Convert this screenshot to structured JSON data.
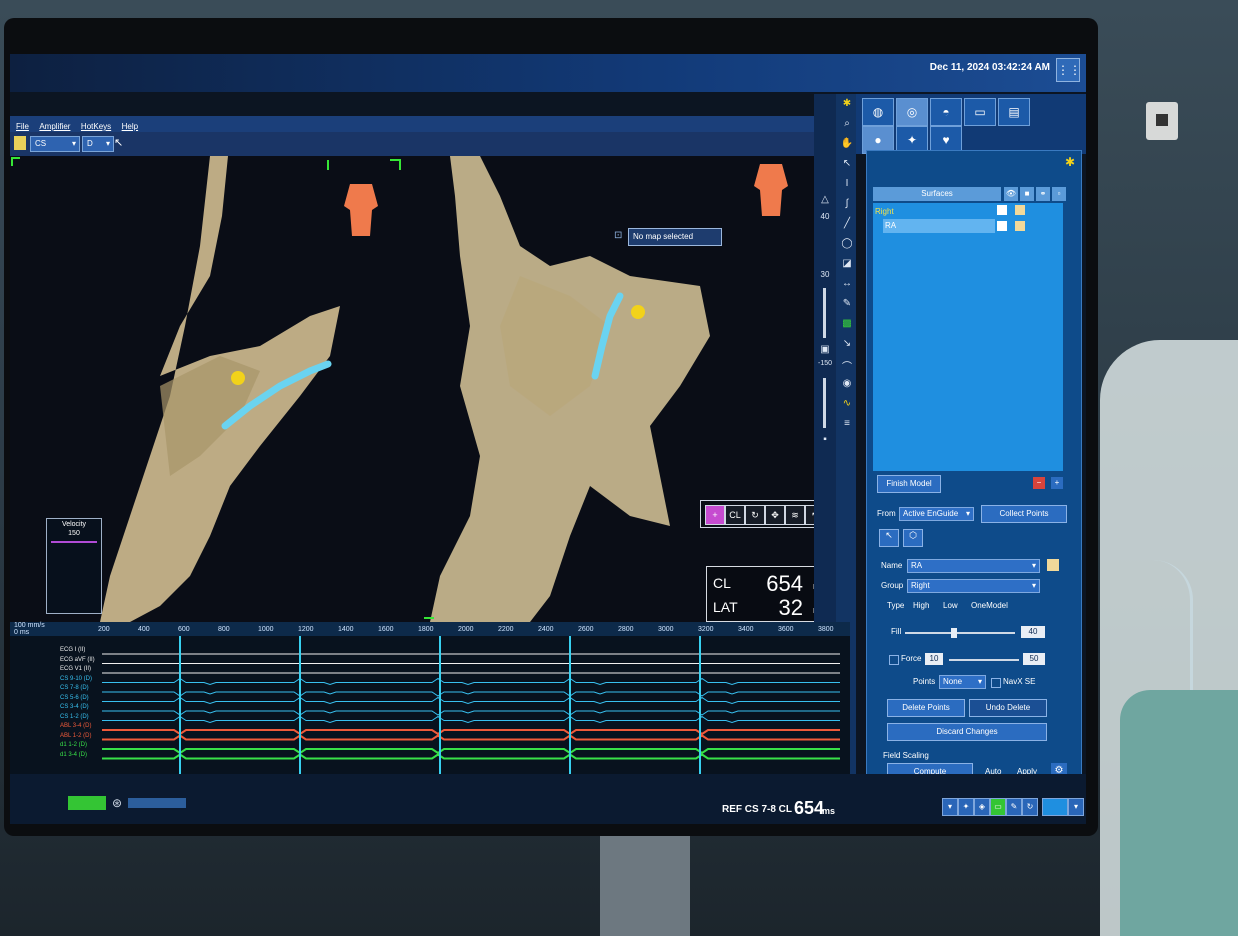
{
  "topbar": {
    "datetime": "Dec 11, 2024 03:42:24 AM",
    "window_button": "⋮⋮"
  },
  "menu": {
    "items": [
      "File",
      "Amplifier",
      "HotKeys",
      "Help"
    ]
  },
  "toolbar": {
    "catheter_select": "CS",
    "catheter_sub_select": "D",
    "map_select": "No map selected"
  },
  "viewport": {
    "velocity": {
      "title": "Velocity",
      "value": "150"
    },
    "cl": {
      "label": "CL",
      "value": "654",
      "unit": "ms"
    },
    "lat": {
      "label": "LAT",
      "value": "32",
      "unit": "ms"
    },
    "zoom_left": "40",
    "scale_a": "30",
    "scale_b": "-150",
    "tool_strip": [
      "+",
      "CL",
      "↻",
      "✥",
      "≋",
      "↖"
    ]
  },
  "panel": {
    "surfaces": {
      "header": "Surfaces",
      "col_icons": [
        "👁",
        "■",
        "⚭",
        "▫"
      ],
      "group": "Right",
      "surface": "RA"
    },
    "finish_model": "Finish Model",
    "from_label": "From",
    "from_value": "Active EnGuide",
    "collect_points": "Collect Points",
    "name_label": "Name",
    "name_value": "RA",
    "group_label": "Group",
    "group_value": "Right",
    "type_label": "Type",
    "type_options": [
      "High",
      "Low",
      "OneModel"
    ],
    "fill_label": "Fill",
    "fill_value": "40",
    "force_label": "Force",
    "force_min": "10",
    "force_max": "50",
    "points_label": "Points",
    "points_value": "None",
    "navx_se": "NavX SE",
    "delete_points": "Delete Points",
    "undo_delete": "Undo Delete",
    "discard_changes": "Discard Changes",
    "field_scaling": "Field Scaling",
    "compute": "Compute",
    "auto": "Auto",
    "apply": "Apply"
  },
  "waveform": {
    "scale_label": "100 mm/s",
    "zero_label": "0 ms",
    "ticks": [
      "200",
      "400",
      "600",
      "800",
      "1000",
      "1200",
      "1400",
      "1600",
      "1800",
      "2000",
      "2200",
      "2400",
      "2600",
      "2800",
      "3000",
      "3200",
      "3400",
      "3600",
      "3800"
    ],
    "channels": [
      "ECG I (II)",
      "ECG aVF (II)",
      "ECG V1 (II)",
      "CS 9-10 (D)",
      "CS 7-8 (D)",
      "CS 5-6 (D)",
      "CS 3-4 (D)",
      "CS 1-2 (D)",
      "ABL 3-4 (D)",
      "ABL 1-2 (D)",
      "d1 1-2 (D)",
      "d1 3-4 (D)"
    ]
  },
  "status": {
    "ref_label": "REF CS 7-8 CL",
    "ref_value": "654",
    "ref_unit": "ms"
  },
  "colors": {
    "accent": "#1f8fe0",
    "mesh": "#d9c89a",
    "catheter": "#6ad3f0",
    "body": "#ef7a4c"
  }
}
